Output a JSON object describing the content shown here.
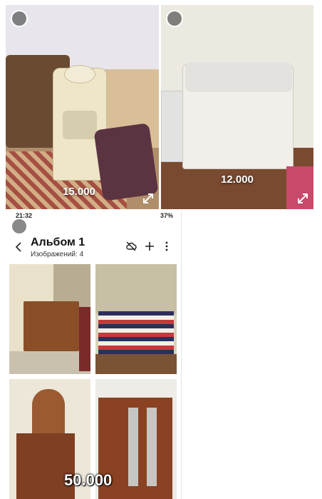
{
  "listings": [
    {
      "price": "15.000",
      "item": "water-cooler"
    },
    {
      "price": "12.000",
      "item": "washing-machine"
    },
    {
      "price": "50.000",
      "item": "bedroom-furniture-set"
    }
  ],
  "phone": {
    "status_time": "21:32",
    "status_right": "37%",
    "album_title": "Альбом 1",
    "album_count": "Изображений: 4"
  },
  "colors": {
    "overlay_text": "#ffffff",
    "select_circle": "#4a4a4a"
  }
}
